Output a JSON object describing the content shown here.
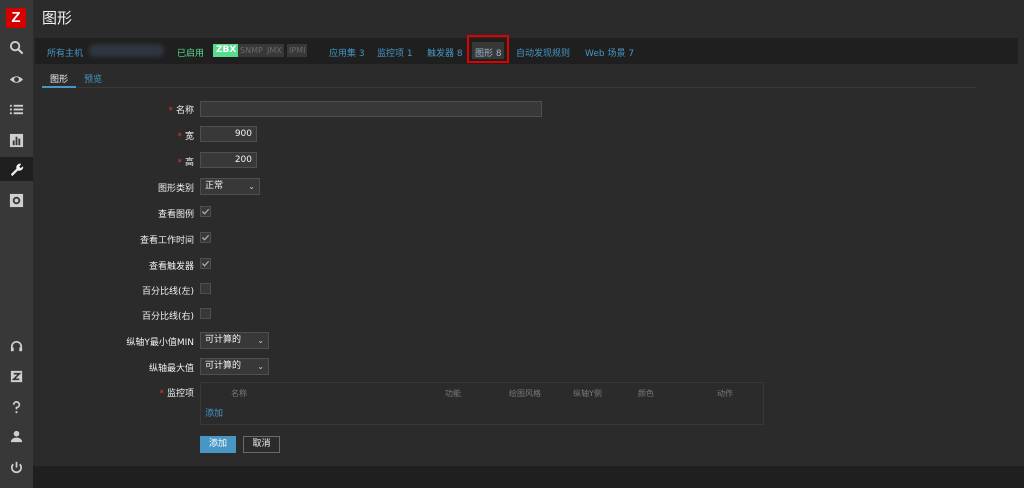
{
  "header": {
    "title": "图形"
  },
  "host_nav": {
    "all_hosts": "所有主机",
    "enabled": "已启用",
    "badges": [
      "ZBX",
      "SNMP",
      "JMX",
      "IPMI"
    ],
    "applications": "应用集 3",
    "items": "监控项 1",
    "triggers": "触发器 8",
    "graphs": "图形 8",
    "discovery": "自动发现规则",
    "web": "Web 场景 7"
  },
  "tabs": {
    "graph": "图形",
    "preview": "预览"
  },
  "form": {
    "name": {
      "label": "名称",
      "value": ""
    },
    "width": {
      "label": "宽",
      "value": "900"
    },
    "height": {
      "label": "高",
      "value": "200"
    },
    "graph_type": {
      "label": "图形类别",
      "value": "正常"
    },
    "show_legend": {
      "label": "查看图例",
      "checked": true
    },
    "show_working_time": {
      "label": "查看工作时间",
      "checked": true
    },
    "show_triggers": {
      "label": "查看触发器",
      "checked": true
    },
    "percentile_left": {
      "label": "百分比线(左)",
      "checked": false
    },
    "percentile_right": {
      "label": "百分比线(右)",
      "checked": false
    },
    "y_min": {
      "label": "纵轴Y最小值MIN",
      "value": "可计算的"
    },
    "y_max": {
      "label": "纵轴最大值",
      "value": "可计算的"
    },
    "items_label": "监控项",
    "items_columns": [
      "名称",
      "功能",
      "绘图风格",
      "纵轴Y侧",
      "颜色",
      "动作"
    ],
    "add_link": "添加"
  },
  "buttons": {
    "add": "添加",
    "cancel": "取消"
  },
  "colors": {
    "accent": "#4796c4",
    "brand": "#d40000",
    "enabled": "#59db8f",
    "highlight": "#e00000"
  },
  "sidebar_icons": [
    "search-icon",
    "eye-icon",
    "list-icon",
    "chart-icon",
    "wrench-icon",
    "gear-icon",
    "headset-icon",
    "zabbix-share-icon",
    "help-icon",
    "user-icon",
    "power-icon"
  ]
}
